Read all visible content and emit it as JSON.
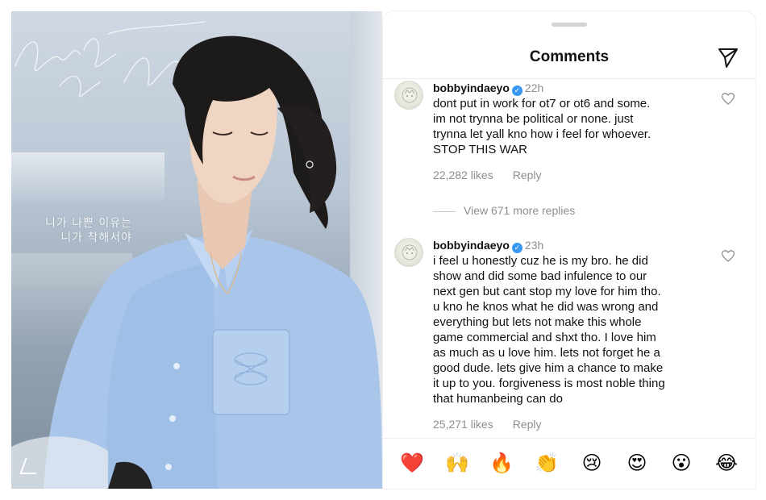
{
  "photo": {
    "korean_lines": [
      "니가 나쁜 이유는",
      "니가 착해서야"
    ]
  },
  "panel": {
    "title": "Comments"
  },
  "comments": [
    {
      "username": "bobbyindaeyo",
      "time": "22h",
      "text": "dont put in work for ot7 or ot6 and some.\nim not trynna be political or none. just\ntrynna let yall kno how i feel for whoever.\nSTOP THIS WAR",
      "likes": "22,282 likes",
      "reply": "Reply"
    },
    {
      "username": "bobbyindaeyo",
      "time": "23h",
      "text": "i feel u honestly cuz he is my bro. he did\nshow and did some bad infulence to our\nnext gen but cant stop my love for him tho.\nu kno he knos what he did was wrong and\neverything but lets not make this whole\ngame commercial and shxt tho. I love him\nas much as u love him. lets not forget he a\ngood dude. lets give him a chance to make\nit up to you. forgiveness is most noble thing\nthat humanbeing can do",
      "likes": "25,271 likes",
      "reply": "Reply"
    }
  ],
  "view_replies": "View 671 more replies",
  "emoji_bar": [
    "❤️",
    "🙌",
    "🔥",
    "👏",
    "😢",
    "😍",
    "😮",
    "😂"
  ],
  "colors": {
    "verified": "#3897f0",
    "secondary_text": "#8e8e8e",
    "shirt": "#a9c6ea"
  },
  "icons": [
    "send-icon",
    "verified-badge-icon",
    "heart-icon"
  ]
}
